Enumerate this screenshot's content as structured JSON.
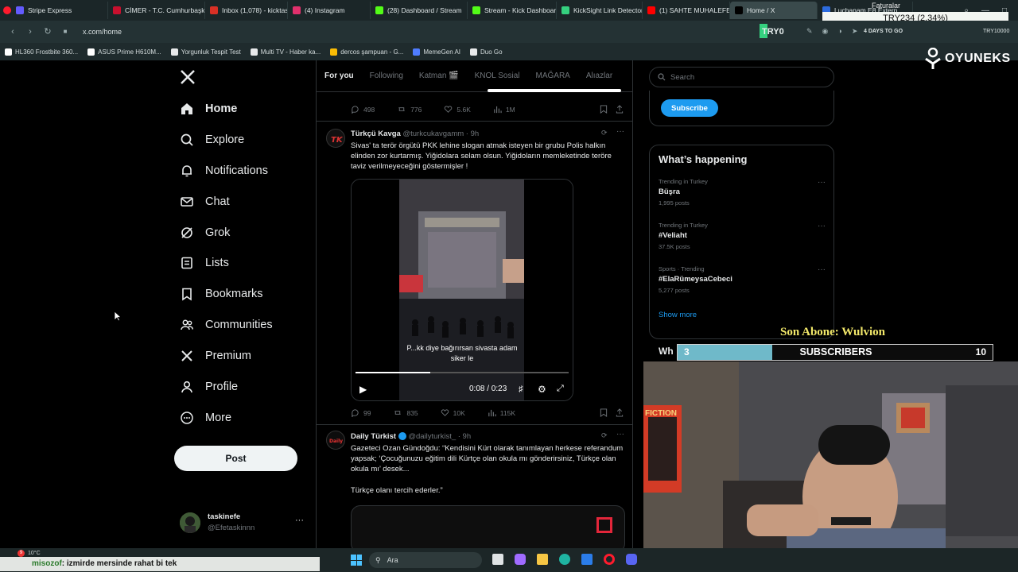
{
  "browser": {
    "tabs": [
      {
        "label": "Stripe Express",
        "color": "#635bff"
      },
      {
        "label": "CİMER - T.C. Cumhurbaşk",
        "color": "#c8102e"
      },
      {
        "label": "Inbox (1,078) - kicktaskin",
        "color": "#d93025"
      },
      {
        "label": "(4) Instagram",
        "color": "#e1306c"
      },
      {
        "label": "(28) Dashboard / Stream",
        "color": "#53fc18"
      },
      {
        "label": "Stream - Kick Dashboard",
        "color": "#53fc18"
      },
      {
        "label": "KickSight Link Detector",
        "color": "#35d07f"
      },
      {
        "label": "(1) SAHTE MUHALEFET ve",
        "color": "#ff0000"
      },
      {
        "label": "Home / X",
        "color": "#000000"
      },
      {
        "label": "Luchanam E8 Extern...",
        "color": "#2d6cdf"
      }
    ],
    "url": "x.com/home",
    "bookmarks": [
      {
        "label": "HL360 Frostbite 360...",
        "color": "#ffffff"
      },
      {
        "label": "ASUS Prime H610M...",
        "color": "#ffffff"
      },
      {
        "label": "Yorgunluk Tespit Test",
        "color": "#e7e9ea"
      },
      {
        "label": "Multi TV - Haber ka...",
        "color": "#e7e9ea"
      },
      {
        "label": "dercos şampuan - G...",
        "color": "#fbbc05"
      },
      {
        "label": "MemeGen AI",
        "color": "#4f7cff"
      },
      {
        "label": "Duo Go",
        "color": "#e7e9ea"
      }
    ],
    "addr_right": {
      "label1": "TRY0",
      "label2": "4 DAYS TO GO",
      "label3": "TRY10000",
      "faturalar": "Faturalar"
    }
  },
  "x": {
    "nav": [
      {
        "label": "Home",
        "icon": "home-icon"
      },
      {
        "label": "Explore",
        "icon": "search-icon"
      },
      {
        "label": "Notifications",
        "icon": "bell-icon"
      },
      {
        "label": "Chat",
        "icon": "mail-icon"
      },
      {
        "label": "Grok",
        "icon": "grok-icon"
      },
      {
        "label": "Lists",
        "icon": "list-icon"
      },
      {
        "label": "Bookmarks",
        "icon": "bookmark-icon"
      },
      {
        "label": "Communities",
        "icon": "people-icon"
      },
      {
        "label": "Premium",
        "icon": "x-icon"
      },
      {
        "label": "Profile",
        "icon": "person-icon"
      },
      {
        "label": "More",
        "icon": "more-icon"
      }
    ],
    "post_button": "Post",
    "account": {
      "name": "taskinefe",
      "handle": "@Efetaskinnn"
    },
    "feed_tabs": [
      "For you",
      "Following",
      "Katman 🎬",
      "KNOL Sosial",
      "MAĞARA",
      "Alıazlar"
    ],
    "top_actions": {
      "replies": "498",
      "reposts": "776",
      "likes": "5.6K",
      "views": "1M"
    },
    "tweet1": {
      "name": "Türkçü Kavga",
      "handle": "@turkcukavgamm · 9h",
      "text": "Sivas' ta terör örgütü PKK lehine slogan atmak isteyen bir grubu Polis halkın elinden zor kurtarmış. Yiğidolara selam olsun. Yiğidoların memleketinde teröre taviz verilmeyeceğini göstermişler !",
      "video_caption": "P...kk diye bağırırsan sivasta adam siker le",
      "video_time": "0:08 / 0:23",
      "replies": "99",
      "reposts": "835",
      "likes": "10K",
      "views": "115K"
    },
    "tweet2": {
      "name": "Daily Türkist",
      "handle": "@dailyturkist_ · 9h",
      "text1": "Gazeteci Ozan Gündoğdu: “Kendisini Kürt olarak tanımlayan herkese referandum yapsak; ‘Çocuğunuzu eğitim dili Kürtçe olan okula mı gönderirsiniz, Türkçe olan okula mı’ desek...",
      "text2": "Türkçe olanı tercih ederler.”"
    },
    "search_placeholder": "Search",
    "subscribe_label": "Subscribe",
    "whats_happening": "What’s happening",
    "trends": [
      {
        "context": "Trending in Turkey",
        "title": "Büşra",
        "posts": "1,995 posts"
      },
      {
        "context": "Trending in Turkey",
        "title": "#Veliaht",
        "posts": "37.5K posts"
      },
      {
        "context": "Sports · Trending",
        "title": "#ElaRümeysaCebeci",
        "posts": "5,277 posts"
      }
    ],
    "show_more": "Show more",
    "who_to_follow_partial": "Wh"
  },
  "overlay": {
    "ticker": "TRY234 (2.34%)",
    "brand": "OYUNEKS",
    "son_abone": "Son Abone: Wulvion",
    "subs_current": "3",
    "subs_label": "SUBSCRIBERS",
    "subs_goal": "10",
    "subs_progress": 0.3,
    "chat_user": "misozof",
    "chat_message": ": izmirde mersinde rahat bi tek",
    "weather": "10°C",
    "badge": "9",
    "poster_text": "FICTION"
  },
  "taskbar": {
    "search_placeholder": "Ara"
  }
}
